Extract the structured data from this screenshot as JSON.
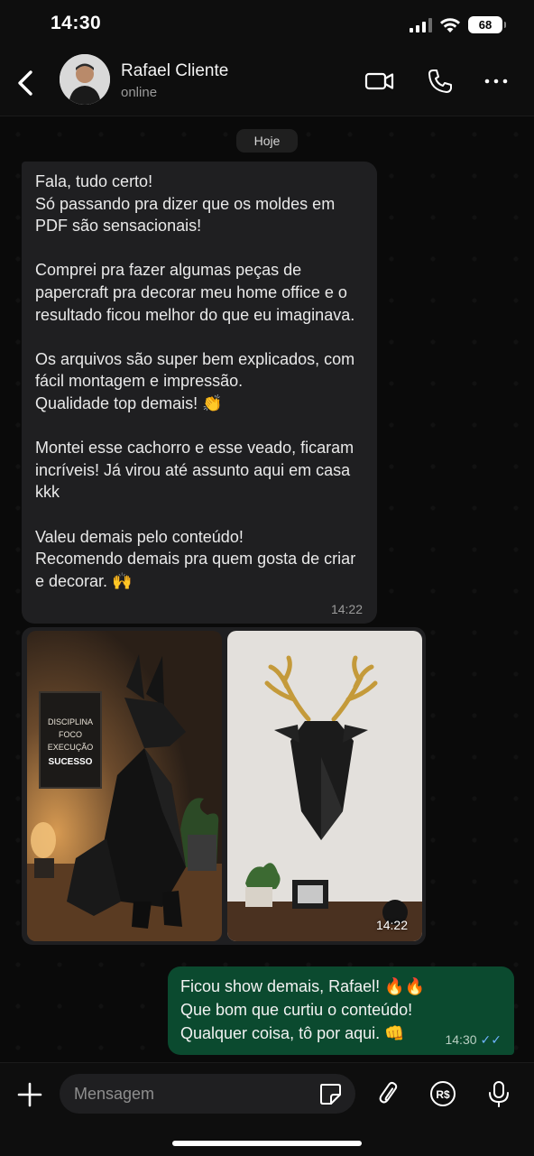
{
  "status_bar": {
    "time": "14:30",
    "battery": "68"
  },
  "header": {
    "contact_name": "Rafael Cliente",
    "contact_status": "online",
    "icons": [
      "back-icon",
      "video-call-icon",
      "phone-icon",
      "more-icon"
    ]
  },
  "chat": {
    "date_chip": "Hoje",
    "incoming": {
      "text": "Fala, tudo certo!\nSó passando pra dizer que os moldes em PDF são sensacionais!\n\nComprei pra fazer algumas peças de papercraft pra decorar meu home office e o resultado ficou melhor do que eu imaginava.\n\nOs arquivos são super bem explicados, com fácil montagem e impressão.\nQualidade top demais! 👏\n\nMontei esse cachorro e esse veado, ficaram incríveis! Já virou até assunto aqui em casa kkk\n\nValeu demais pelo conteúdo!\nRecomendo demais pra quem gosta de criar e decorar. 🙌",
      "time": "14:22"
    },
    "photos": {
      "time": "14:22",
      "left_poster_lines": [
        "DISCIPLINA",
        "FOCO",
        "EXECUÇÃO",
        "SUCESSO"
      ]
    },
    "outgoing": {
      "text": "Ficou show demais, Rafael! 🔥🔥\nQue bom que curtiu o conteúdo!\nQualquer coisa, tô por aqui. 👊",
      "time": "14:30",
      "ticks": "✓✓"
    }
  },
  "composer": {
    "placeholder": "Mensagem",
    "icons": [
      "plus-icon",
      "sticker-icon",
      "attach-icon",
      "payment-icon",
      "mic-icon"
    ]
  },
  "colors": {
    "background": "#0a0a0a",
    "incoming_bubble": "#1f1f21",
    "outgoing_bubble": "#0b4a2f",
    "read_ticks": "#6fb4ff"
  }
}
